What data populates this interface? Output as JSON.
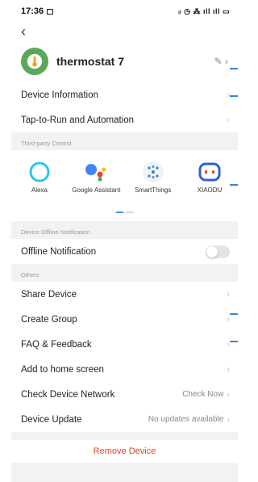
{
  "status_bar": {
    "time": "17:36",
    "icons_text": "ᵢₗ ◷ ⁂ ıll ıll ▭"
  },
  "nav": {
    "back_glyph": "‹"
  },
  "device": {
    "name": "thermostat 7",
    "icon_color": "#5aa95a"
  },
  "rows_top": [
    {
      "label": "Device Information"
    },
    {
      "label": "Tap-to-Run and Automation"
    }
  ],
  "third_party": {
    "section_label": "Third-party Control",
    "items": [
      {
        "label": "Alexa",
        "icon": "alexa-icon"
      },
      {
        "label": "Google Assistant",
        "icon": "google-assistant-icon"
      },
      {
        "label": "SmartThings",
        "icon": "smartthings-icon"
      },
      {
        "label": "XIAODU",
        "icon": "xiaodu-icon"
      }
    ]
  },
  "offline": {
    "section_label": "Device Offline Notification",
    "label": "Offline Notification",
    "enabled": false
  },
  "others": {
    "section_label": "Others",
    "rows": [
      {
        "label": "Share Device",
        "value": ""
      },
      {
        "label": "Create Group",
        "value": ""
      },
      {
        "label": "FAQ & Feedback",
        "value": ""
      },
      {
        "label": "Add to home screen",
        "value": ""
      },
      {
        "label": "Check Device Network",
        "value": "Check Now"
      },
      {
        "label": "Device Update",
        "value": "No updates available"
      }
    ]
  },
  "remove_label": "Remove Device",
  "colors": {
    "accent": "#4a8bf0",
    "danger": "#e5432f",
    "marker": "#3a86c8"
  }
}
